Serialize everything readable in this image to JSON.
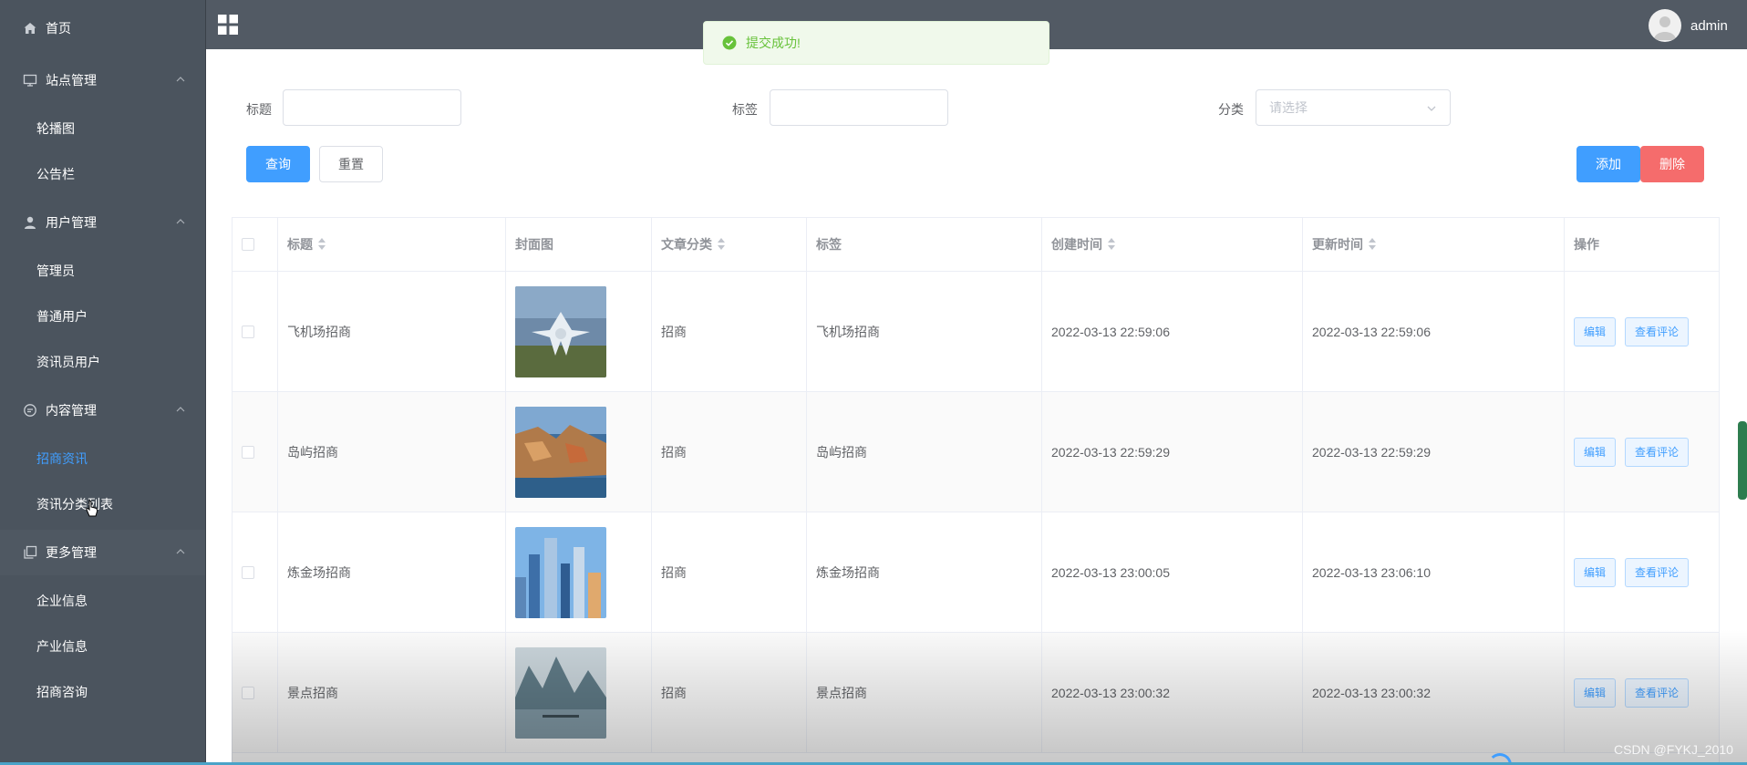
{
  "sidebar": {
    "home": "首页",
    "groups": [
      {
        "label": "站点管理",
        "icon": "monitor-icon",
        "items": [
          "轮播图",
          "公告栏"
        ]
      },
      {
        "label": "用户管理",
        "icon": "user-icon",
        "items": [
          "管理员",
          "普通用户",
          "资讯员用户"
        ]
      },
      {
        "label": "内容管理",
        "icon": "chat-icon",
        "items": [
          "招商资讯",
          "资讯分类列表"
        ]
      },
      {
        "label": "更多管理",
        "icon": "copy-icon",
        "items": [
          "企业信息",
          "产业信息",
          "招商咨询"
        ]
      }
    ],
    "active_item": "招商资讯"
  },
  "header": {
    "username": "admin"
  },
  "toast": {
    "message": "提交成功!",
    "color": "#67c23a"
  },
  "search": {
    "title_label": "标题",
    "tag_label": "标签",
    "category_label": "分类",
    "category_placeholder": "请选择",
    "query_button": "查询",
    "reset_button": "重置",
    "add_button": "添加",
    "delete_button": "删除"
  },
  "table": {
    "columns": [
      "标题",
      "封面图",
      "文章分类",
      "标签",
      "创建时间",
      "更新时间",
      "操作"
    ],
    "rows": [
      {
        "title": "飞机场招商",
        "category": "招商",
        "tag": "飞机场招商",
        "created": "2022-03-13 22:59:06",
        "updated": "2022-03-13 22:59:06"
      },
      {
        "title": "岛屿招商",
        "category": "招商",
        "tag": "岛屿招商",
        "created": "2022-03-13 22:59:29",
        "updated": "2022-03-13 22:59:29"
      },
      {
        "title": "炼金场招商",
        "category": "招商",
        "tag": "炼金场招商",
        "created": "2022-03-13 23:00:05",
        "updated": "2022-03-13 23:06:10"
      },
      {
        "title": "景点招商",
        "category": "招商",
        "tag": "景点招商",
        "created": "2022-03-13 23:00:32",
        "updated": "2022-03-13 23:00:32"
      }
    ],
    "edit_label": "编辑",
    "comments_label": "查看评论"
  },
  "watermark": "CSDN @FYKJ_2010",
  "colors": {
    "primary": "#409eff",
    "danger": "#f56c6c",
    "sidebar": "#4b545e",
    "header": "#525a64"
  }
}
